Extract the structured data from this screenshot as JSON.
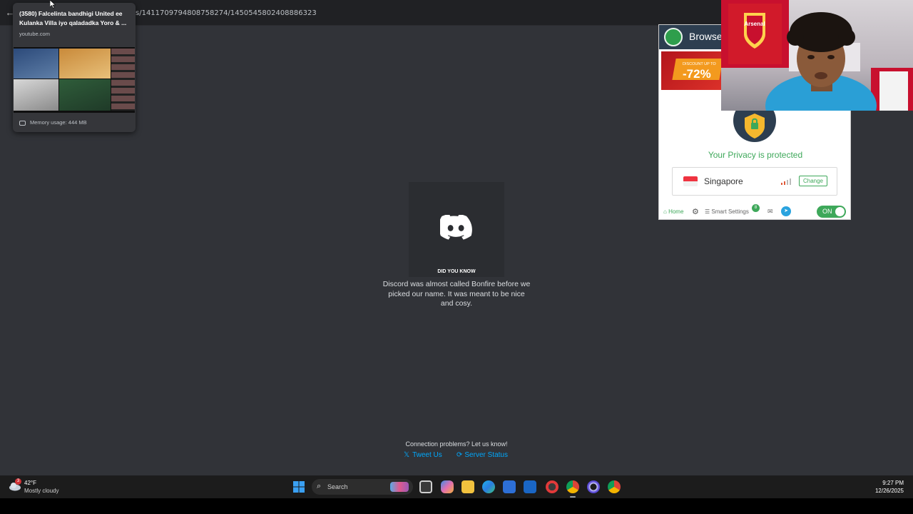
{
  "browser": {
    "url_fragment": "s/1411709794808758274/1450545802408886323"
  },
  "tab_hover": {
    "title": "(3580) Falcelinta bandhigi United ee Kulanka Villa iyo qaladadka Yoro & ...",
    "domain": "youtube.com",
    "memory": "Memory usage: 444 MB"
  },
  "discord": {
    "tip_heading": "DID YOU KNOW",
    "tip_text": "Discord was almost called Bonfire before we picked our name. It was meant to be nice and cosy.",
    "connection_text": "Connection problems? Let us know!",
    "tweet_label": "Tweet Us",
    "status_label": "Server Status",
    "accent": "#00a8fc"
  },
  "vpn": {
    "brand": "Browse",
    "promo_small": "DISCOUNT UP TO",
    "promo_big": "-72%",
    "protected_text": "Your Privacy is protected",
    "location": "Singapore",
    "change_label": "Change",
    "home_label": "Home",
    "smart_settings_label": "Smart Settings",
    "smart_badge": "8",
    "toggle_label": "ON",
    "accent": "#3ea85a"
  },
  "webcam": {
    "shirt_text": "Arsenal"
  },
  "taskbar": {
    "weather_badge": "3",
    "weather_temp": "42°F",
    "weather_desc": "Mostly cloudy",
    "search_label": "Search",
    "time": "9:27 PM",
    "date": "12/26/2025",
    "apps": [
      "task-view",
      "copilot",
      "file-explorer",
      "edge",
      "store",
      "outlook",
      "app-red",
      "chrome",
      "obs",
      "chrome-profile"
    ]
  }
}
